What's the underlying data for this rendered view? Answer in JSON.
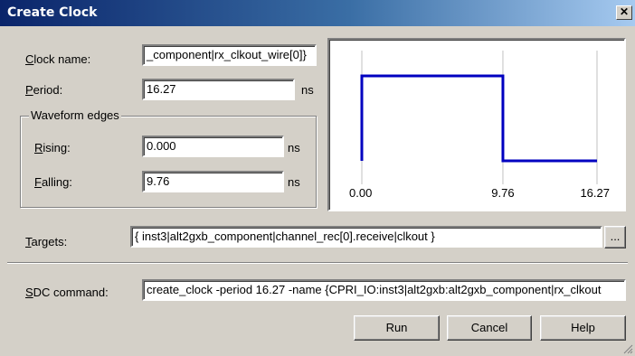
{
  "window": {
    "title": "Create Clock",
    "close_glyph": "✕"
  },
  "clock_name": {
    "label": "Clock name:",
    "accel": "C",
    "rest": "lock name:",
    "value": "_component|rx_clkout_wire[0]}"
  },
  "period": {
    "label": "Period:",
    "accel": "P",
    "rest": "eriod:",
    "value": "16.27",
    "unit": "ns"
  },
  "waveform_edges": {
    "title": "Waveform edges",
    "rising": {
      "label": "Rising:",
      "accel": "R",
      "rest": "ising:",
      "value": "0.000",
      "unit": "ns"
    },
    "falling": {
      "label": "Falling:",
      "accel": "F",
      "rest": "alling:",
      "value": "9.76",
      "unit": "ns"
    }
  },
  "waveform_preview": {
    "period": 16.27,
    "rising": 0.0,
    "falling": 9.76,
    "tick_labels": [
      "0.00",
      "9.76",
      "16.27"
    ],
    "line_color": "#0000c0",
    "gridline_color": "#c0c0c0"
  },
  "targets": {
    "label": "Targets:",
    "accel": "T",
    "rest": "argets:",
    "value": "{ inst3|alt2gxb_component|channel_rec[0].receive|clkout }",
    "browse_label": "..."
  },
  "sdc": {
    "label": "SDC command:",
    "accel": "S",
    "rest": "DC command:",
    "value": "create_clock -period 16.27 -name {CPRI_IO:inst3|alt2gxb:alt2gxb_component|rx_clkout"
  },
  "buttons": {
    "run": "Run",
    "cancel": "Cancel",
    "help": "Help"
  }
}
